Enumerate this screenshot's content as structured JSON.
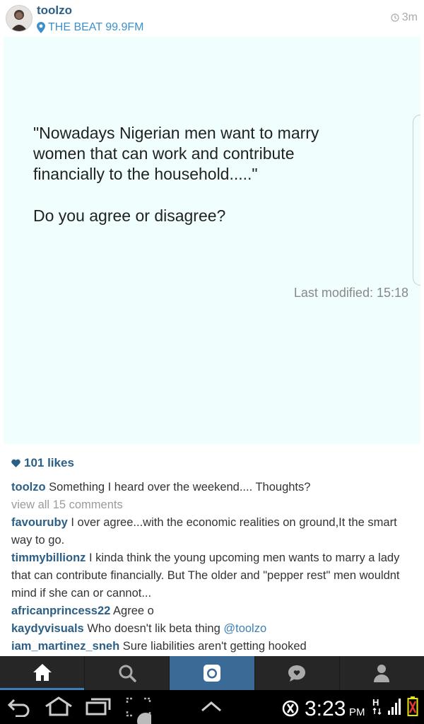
{
  "post": {
    "username": "toolzo",
    "location": "THE BEAT 99.9FM",
    "time_ago": "3m"
  },
  "photo": {
    "quote": "\"Nowadays Nigerian men want to marry women that can work and contribute financially to the household.....\"",
    "question": "Do you agree or disagree?",
    "last_modified": "Last modified: 15:18"
  },
  "likes": "101 likes",
  "caption": {
    "user": "toolzo",
    "text": "Something I heard over the weekend.... Thoughts?"
  },
  "view_all": "view all 15 comments",
  "comments": [
    {
      "user": "favouruby",
      "text": "I over agree...with the economic realities on ground,It the smart way to go."
    },
    {
      "user": "timmybillionz",
      "text": "I kinda think the young upcoming men wants to marry a lady that can contribute financially. But The older and \"pepper rest\" men wouldnt mind if she can or cannot..."
    },
    {
      "user": "africanprincess22",
      "text": "Agree o"
    },
    {
      "user": "kaydyvisuals",
      "text": "Who doesn't lik beta thing",
      "mention": "@toolzo"
    },
    {
      "user": "iam_martinez_sneh",
      "text": "Sure liabilities aren't getting hooked"
    }
  ],
  "tabs": [
    {
      "name": "home-icon"
    },
    {
      "name": "search-icon"
    },
    {
      "name": "camera-icon"
    },
    {
      "name": "activity-icon"
    },
    {
      "name": "profile-icon"
    }
  ],
  "status": {
    "time": "3:23",
    "ampm": "PM",
    "network": "H"
  },
  "colors": {
    "username": "#2c5f86",
    "location": "#3d90c8",
    "photo_bg": "#f0fefe",
    "tab_active": "#3b6a96",
    "tabbar_bg": "#262626",
    "battery": "#e53935"
  }
}
